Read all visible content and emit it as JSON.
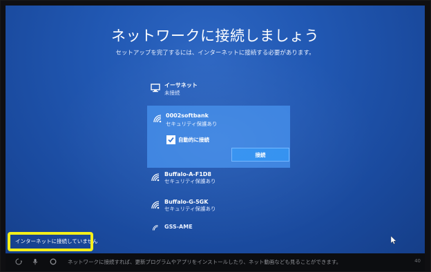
{
  "page": {
    "title": "ネットワークに接続しましょう",
    "subtitle": "セットアップを完了するには、インターネットに接続する必要があります。"
  },
  "networks": [
    {
      "name": "イーサネット",
      "status": "未接続",
      "icon": "ethernet-icon"
    },
    {
      "name": "0002softbank",
      "status": "セキュリティ保護あり",
      "icon": "wifi-icon",
      "selected": true,
      "auto_connect_label": "自動的に接続",
      "auto_connect_checked": true,
      "connect_button_label": "接続"
    },
    {
      "name": "Buffalo-A-F1D8",
      "status": "セキュリティ保護あり",
      "icon": "wifi-icon"
    },
    {
      "name": "Buffalo-G-5GK",
      "status": "セキュリティ保護あり",
      "icon": "wifi-icon"
    },
    {
      "name": "GSS-AME",
      "status": "",
      "icon": "wifi-icon"
    }
  ],
  "status_bar": {
    "no_internet": "インターネットに接続していません"
  },
  "taskbar": {
    "message": "ネットワークに接続すれば、更新プログラムやアプリをインストールしたり、ネット動画なども見ることができます。",
    "right_label": "40"
  },
  "colors": {
    "screen_blue": "#2158b3",
    "selected_panel": "#3a82e0",
    "connect_button": "#2f8ff0",
    "highlight": "#f4ef1a"
  }
}
